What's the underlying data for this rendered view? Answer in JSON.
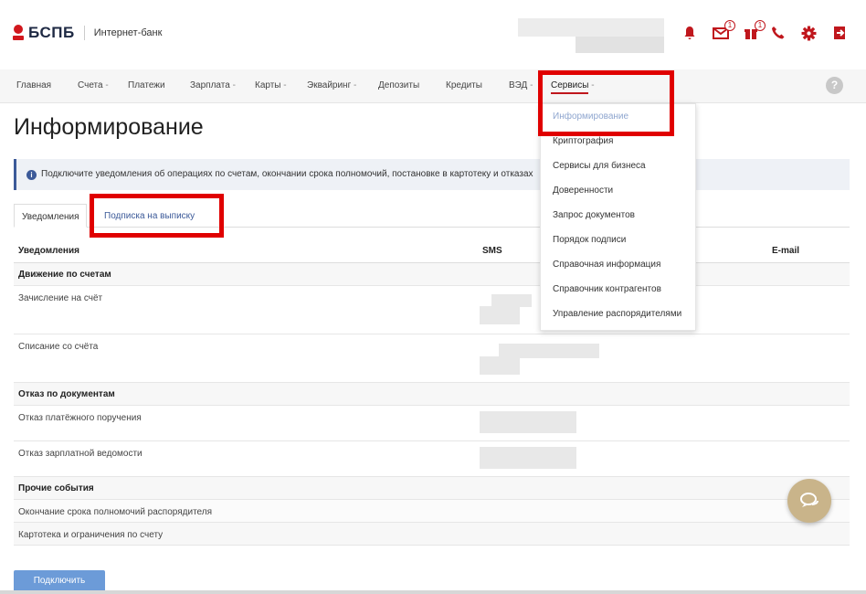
{
  "header": {
    "logo_text": "БСПБ",
    "subtitle": "Интернет-банк",
    "badges": {
      "messages": "1",
      "gifts": "1"
    },
    "icons": [
      "bell-icon",
      "envelope-icon",
      "gift-icon",
      "phone-icon",
      "gear-icon",
      "logout-icon"
    ]
  },
  "nav": {
    "items": [
      {
        "label": "Главная",
        "caret": ""
      },
      {
        "label": "Счета",
        "caret": " -"
      },
      {
        "label": "Платежи",
        "caret": ""
      },
      {
        "label": "Зарплата",
        "caret": " -"
      },
      {
        "label": "Карты",
        "caret": " -"
      },
      {
        "label": "Эквайринг",
        "caret": " -"
      },
      {
        "label": "Депозиты",
        "caret": ""
      },
      {
        "label": "Кредиты",
        "caret": ""
      },
      {
        "label": "ВЭД",
        "caret": " -"
      },
      {
        "label": "Сервисы",
        "caret": " -"
      }
    ],
    "help": "?"
  },
  "services_menu": {
    "items": [
      "Информирование",
      "Криптография",
      "Сервисы для бизнеса",
      "Доверенности",
      "Запрос документов",
      "Порядок подписи",
      "Справочная информация",
      "Справочник контрагентов",
      "Управление распорядителями"
    ]
  },
  "page": {
    "title": "Информирование",
    "info_icon": "i",
    "info_text": "Подключите уведомления об операциях по счетам, окончании срока полномочий, постановке в картотеку и отказах",
    "tabs": [
      "Уведомления",
      "Подписка на выписку"
    ],
    "table": {
      "headers": [
        "Уведомления",
        "SMS",
        "E-mail"
      ],
      "sections": [
        {
          "title": "Движение по счетам",
          "rows": [
            "Зачисление на счёт",
            "Списание со счёта"
          ]
        },
        {
          "title": "Отказ по документам",
          "rows": [
            "Отказ платёжного поручения",
            "Отказ зарплатной ведомости"
          ]
        },
        {
          "title": "Прочие события",
          "rows": [
            "Окончание срока полномочий распорядителя",
            "Картотека и ограничения по счету"
          ]
        }
      ]
    },
    "connect_button": "Подключить"
  },
  "colors": {
    "brand_red": "#d1171d",
    "accent_blue": "#3c5a99",
    "highlight": "#e00000"
  }
}
